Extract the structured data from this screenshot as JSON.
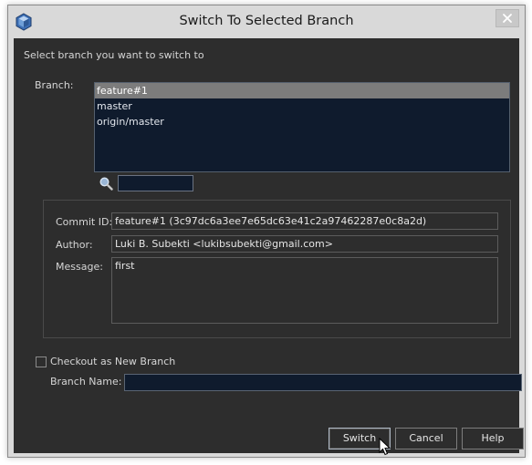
{
  "window": {
    "title": "Switch To Selected Branch"
  },
  "instructions": "Select branch you want to switch to",
  "branch": {
    "label": "Branch:",
    "items": [
      {
        "name": "feature#1",
        "selected": true
      },
      {
        "name": "master",
        "selected": false
      },
      {
        "name": "origin/master",
        "selected": false
      }
    ],
    "search_value": ""
  },
  "details": {
    "commit_id_label": "Commit ID:",
    "commit_id_value": "feature#1 (3c97dc6a3ee7e65dc63e41c2a97462287e0c8a2d)",
    "author_label": "Author:",
    "author_value": "Luki B. Subekti <lukibsubekti@gmail.com>",
    "message_label": "Message:",
    "message_value": "first"
  },
  "checkout_new_branch": {
    "label": "Checkout as New Branch",
    "checked": false
  },
  "branch_name": {
    "label": "Branch Name:",
    "value": ""
  },
  "buttons": {
    "switch": "Switch",
    "cancel": "Cancel",
    "help": "Help"
  },
  "colors": {
    "panel_bg": "#2d2d2d",
    "list_bg": "#0f1b2d",
    "selection": "#7c7c7c",
    "titlebar": "#d9d9d9"
  },
  "icons": {
    "app": "netbeans-cube-icon",
    "close": "close-icon",
    "search": "search-icon",
    "cursor": "mouse-pointer-icon"
  }
}
